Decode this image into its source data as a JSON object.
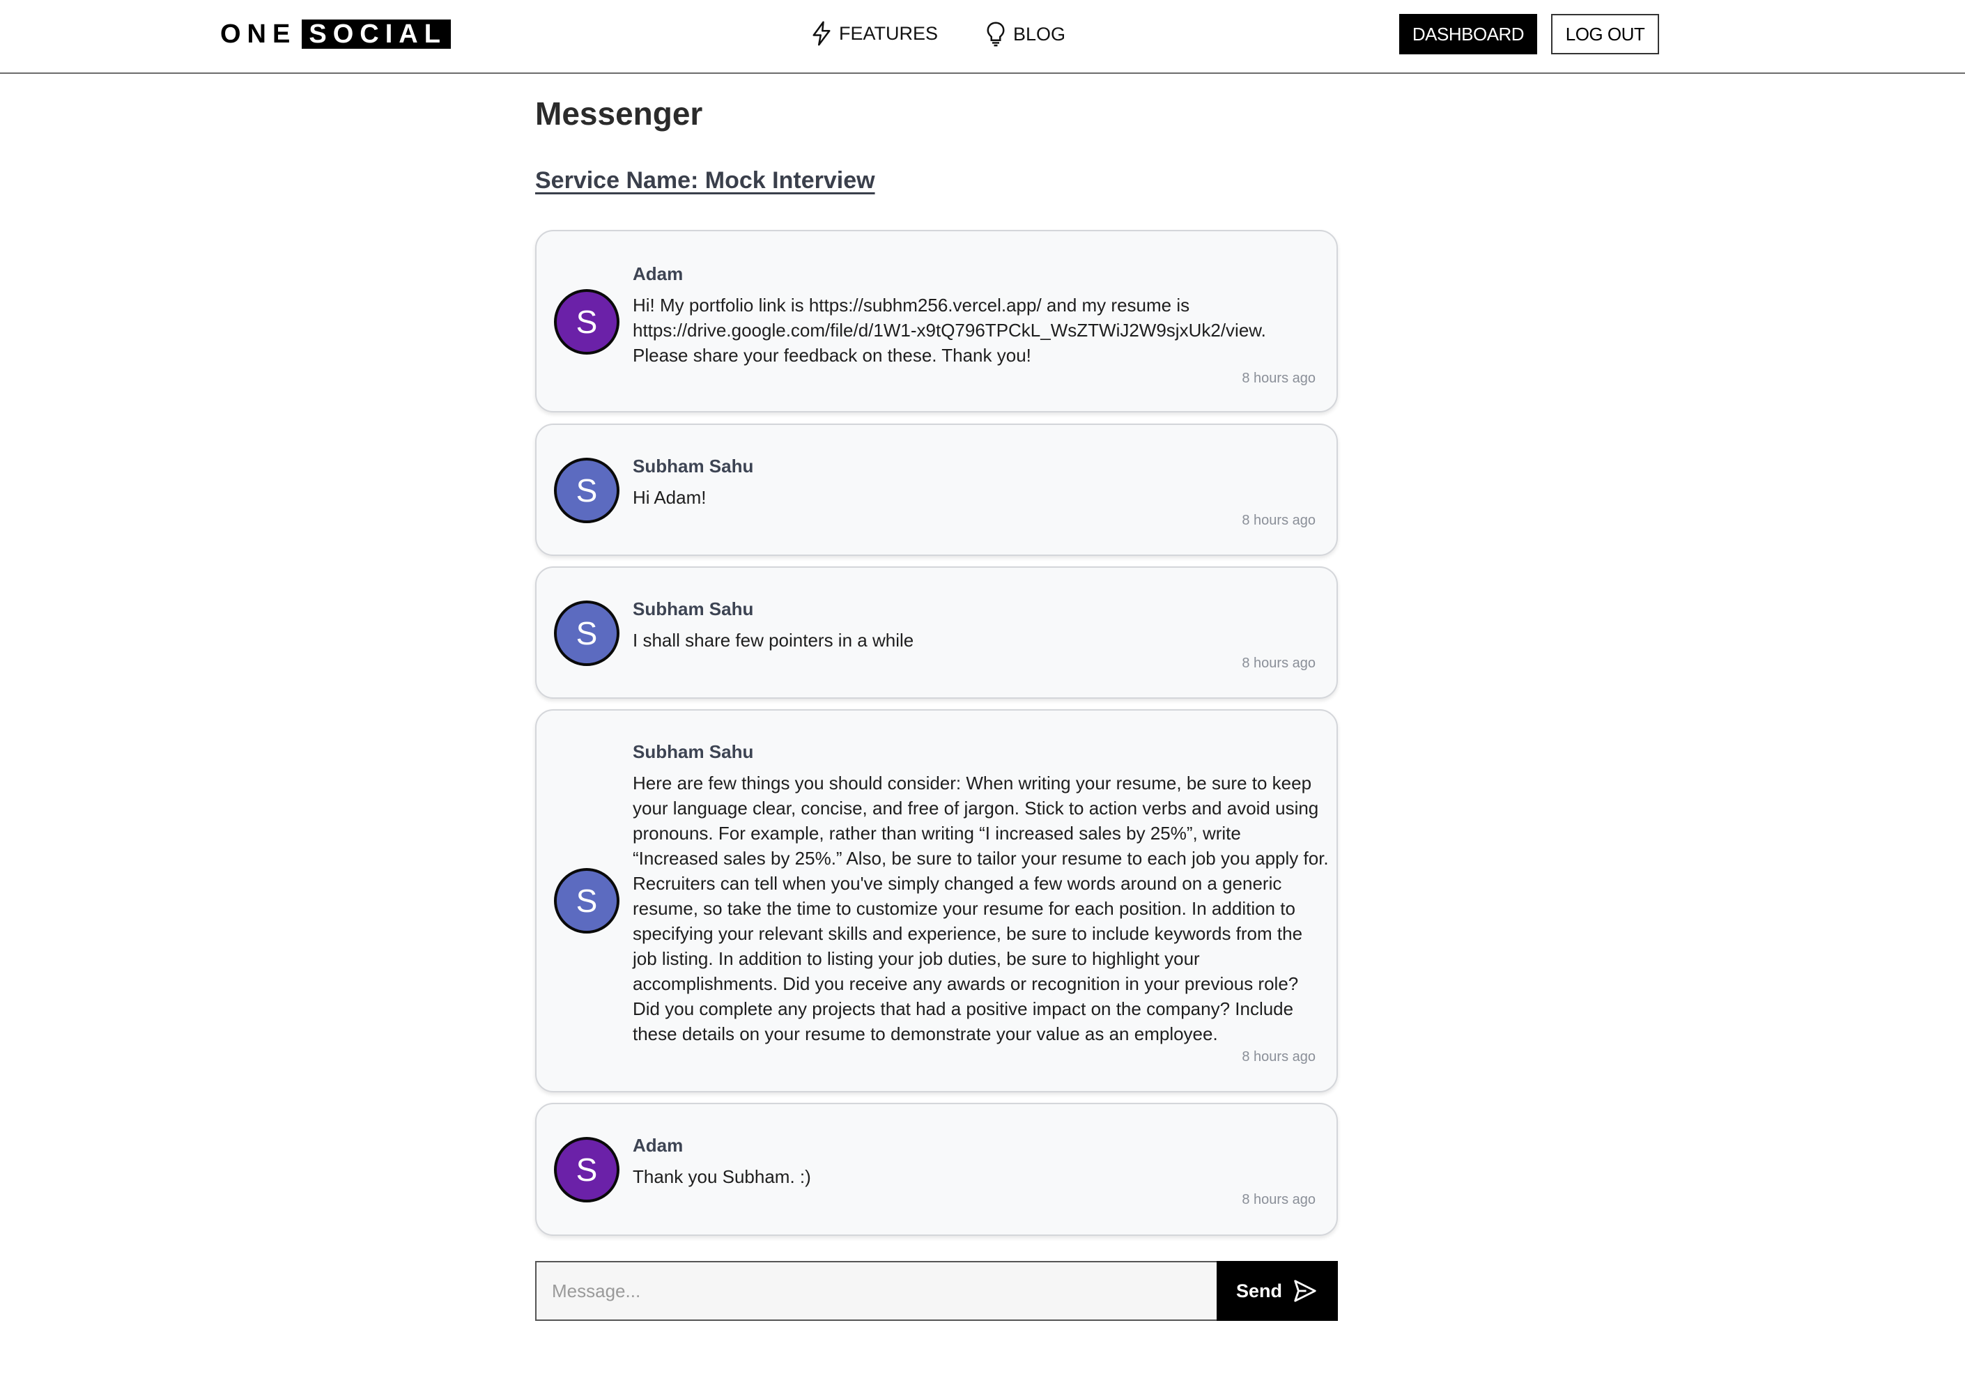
{
  "header": {
    "logo_left": "ONE",
    "logo_right": "SOCIAL",
    "nav": [
      {
        "label": "FEATURES",
        "icon": "lightning-icon"
      },
      {
        "label": "BLOG",
        "icon": "lightbulb-icon"
      }
    ],
    "dashboard_label": "DASHBOARD",
    "logout_label": "LOG OUT"
  },
  "page": {
    "title": "Messenger",
    "service": "Service Name: Mock Interview"
  },
  "messages": [
    {
      "sender": "Adam",
      "initial": "S",
      "avatar_color": "#6b21a8",
      "lines": [
        "Hi! My portfolio link is https://subhm256.vercel.app/ and my resume is",
        "https://drive.google.com/file/d/1W1-x9tQ796TPCkL_WsZTWiJ2W9sjxUk2/view.",
        "Please share your feedback on these. Thank you!"
      ],
      "time": "8 hours ago"
    },
    {
      "sender": "Subham Sahu",
      "initial": "S",
      "avatar_color": "#5c6bc0",
      "lines": [
        "Hi Adam!"
      ],
      "time": "8 hours ago"
    },
    {
      "sender": "Subham Sahu",
      "initial": "S",
      "avatar_color": "#5c6bc0",
      "lines": [
        "I shall share few pointers in a while"
      ],
      "time": "8 hours ago"
    },
    {
      "sender": "Subham Sahu",
      "initial": "S",
      "avatar_color": "#5c6bc0",
      "lines": [
        "Here are few things you should consider: When writing your resume, be sure to keep",
        "your language clear, concise, and free of jargon. Stick to action verbs and avoid using",
        "pronouns. For example, rather than writing “I increased sales by 25%”, write",
        "“Increased sales by 25%.” Also, be sure to tailor your resume to each job you apply for.",
        "Recruiters can tell when you've simply changed a few words around on a generic",
        "resume, so take the time to customize your resume for each position. In addition to",
        "specifying your relevant skills and experience, be sure to include keywords from the",
        "job listing. In addition to listing your job duties, be sure to highlight your",
        "accomplishments. Did you receive any awards or recognition in your previous role?",
        "Did you complete any projects that had a positive impact on the company? Include",
        "these details on your resume to demonstrate your value as an employee."
      ],
      "time": "8 hours ago"
    },
    {
      "sender": "Adam",
      "initial": "S",
      "avatar_color": "#6b21a8",
      "lines": [
        "Thank you Subham. :)"
      ],
      "time": "8 hours ago"
    }
  ],
  "composer": {
    "placeholder": "Message...",
    "send_label": "Send",
    "send_icon": "send-icon"
  }
}
